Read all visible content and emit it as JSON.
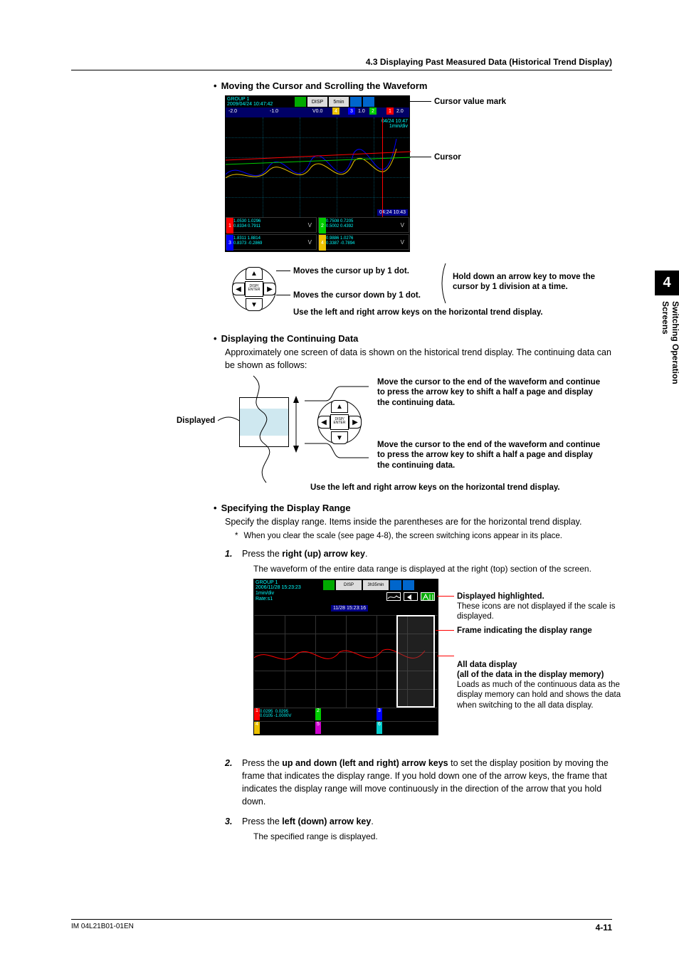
{
  "header": "4.3  Displaying Past Measured Data (Historical Trend Display)",
  "sideTab": {
    "num": "4",
    "label": "Switching Operation Screens"
  },
  "footer": {
    "docid": "IM 04L21B01-01EN",
    "page": "4-11"
  },
  "sec1": {
    "heading": "Moving the Cursor and Scrolling the Waveform",
    "callout_mark": "Cursor value mark",
    "callout_cursor": "Cursor",
    "cursor_up": "Moves the cursor up by 1 dot.",
    "cursor_down": "Moves the cursor down by 1 dot.",
    "hold": "Hold down an arrow key to move the cursor by 1 division at a time.",
    "horiz": "Use the left and right arrow keys on the horizontal trend display.",
    "disp_enter": "DISP/\nENTER"
  },
  "shot1": {
    "group": "GROUP 1",
    "datetime": "2009/04/24 10:47:42",
    "disp_badge": "DISP",
    "rate_badge": "5min",
    "scale_ticks": [
      "-2.0",
      "-1.0",
      "V0.0",
      "1.0",
      "2.0"
    ],
    "ch_marks": [
      "4",
      "3",
      "2",
      "1"
    ],
    "time_lbl_top": "04/24 10:47",
    "time_rate": "1min/div",
    "time_lbl_bot": "04:24 10:43",
    "readouts": [
      {
        "n": "1",
        "bg": "#f00",
        "l1": "1.0530  1.0296",
        "l2": "0.8334  0.7911",
        "u": "V"
      },
      {
        "n": "2",
        "bg": "#0c0",
        "l1": "0.7508  0.7205",
        "l2": "0.5002  0.4392",
        "u": "V"
      },
      {
        "n": "3",
        "bg": "#00f",
        "l1": "1.8311  1.8814",
        "l2": "0.8373 -0.2869",
        "u": "V"
      },
      {
        "n": "4",
        "bg": "#ecc100",
        "l1": "0.9886  1.0276",
        "l2": "0.3387 -0.7894",
        "u": "V"
      }
    ]
  },
  "sec2": {
    "heading": "Displaying the Continuing Data",
    "intro": "Approximately one screen of data is shown on the historical trend display. The continuing data can be shown as follows:",
    "displayed": "Displayed",
    "move_up": "Move the cursor to the end of the waveform and continue to press the arrow key to shift a half a page and display the continuing data.",
    "move_down": "Move the cursor to the end of the waveform and continue to press the arrow key to shift a half a page and display the continuing data.",
    "horiz": "Use the left and right arrow keys on the horizontal trend display."
  },
  "sec3": {
    "heading": "Specifying the Display Range",
    "intro": "Specify the display range. Items inside the parentheses are for the horizontal trend display.",
    "footnote": "When you clear the scale (see page 4-8), the screen switching icons appear in its place.",
    "step1_lead": "Press the ",
    "step1_bold": "right (up) arrow key",
    "step1_sub": "The waveform of the entire data range is displayed at the right (top) section of the screen.",
    "c_disp_hl": "Displayed highlighted.",
    "c_disp_hl_sub": "These icons are not displayed if the scale is displayed.",
    "c_frame": "Frame indicating the display range",
    "c_all_title": "All data display",
    "c_all_bold": "(all of the data in the display memory)",
    "c_all_sub": "Loads as much of the continuous data as the display memory can hold and shows the data when switching to the all data display.",
    "step2_lead": "Press the ",
    "step2_bold": "up and down (left and right) arrow keys",
    "step2_rest": " to set the display position by moving the frame that indicates the display range. If you hold down one of the arrow keys, the frame that indicates the display range will move continuously in the direction of the arrow that you hold down.",
    "step3_lead": "Press the ",
    "step3_bold": "left (down) arrow key",
    "step3_sub": "The specified range is displayed."
  },
  "shot2": {
    "group": "GROUP 1",
    "datetime": "2006/11/28 15:23:23",
    "disp_badge": "DISP",
    "rate_badge": "3h35min",
    "rate_row1": "1min/div",
    "rate_row2": "Rate:s1",
    "tlabel": "11/28 15:23:16",
    "legend": [
      {
        "n": "1",
        "bg": "#f00",
        "tx": "0.0295  0.0295\n0.0105 -1.0000V"
      },
      {
        "n": "2",
        "bg": "#0c0",
        "tx": ""
      },
      {
        "n": "3",
        "bg": "#00f",
        "tx": ""
      },
      {
        "n": "4",
        "bg": "#ecc100",
        "tx": ""
      },
      {
        "n": "5",
        "bg": "#c0c",
        "tx": ""
      },
      {
        "n": "6",
        "bg": "#0cc",
        "tx": ""
      }
    ]
  }
}
